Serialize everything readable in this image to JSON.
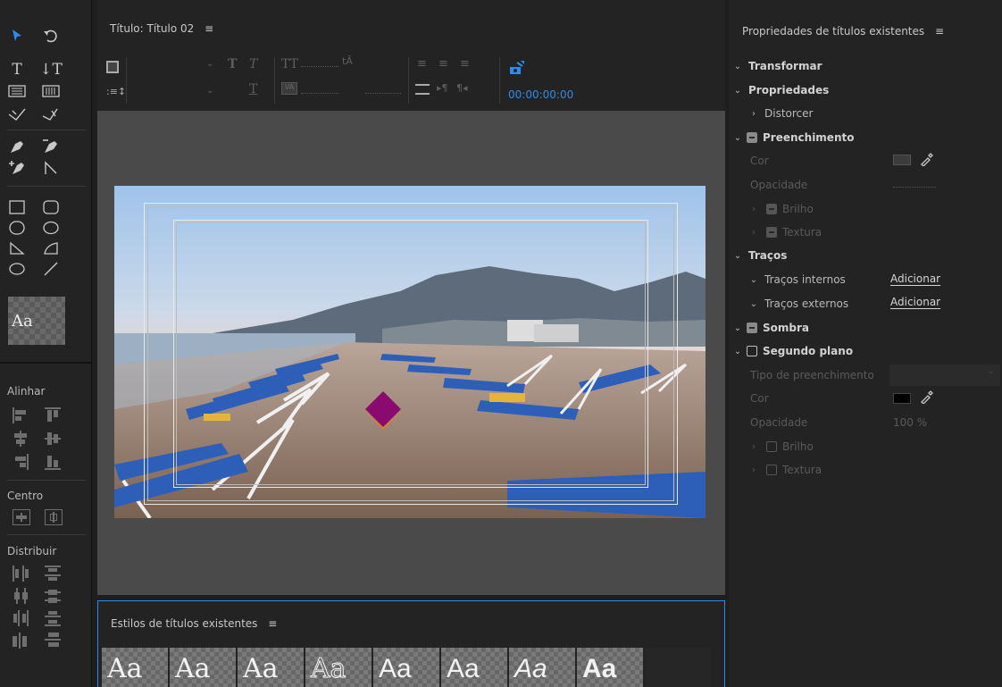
{
  "title_panel": {
    "heading": "Título: Título 02",
    "timecode": "00:00:00:00"
  },
  "tools_panel": {
    "align_label": "Alinhar",
    "center_label": "Centro",
    "distribute_label": "Distribuir",
    "style_swatch": "Aa"
  },
  "styles_panel": {
    "heading": "Estilos de títulos existentes",
    "tiles": [
      "Aa",
      "Aa",
      "Aa",
      "Aa",
      "Aa",
      "Aa",
      "Aa",
      "Aa"
    ]
  },
  "properties": {
    "heading": "Propriedades de títulos existentes",
    "transformar": "Transformar",
    "propriedades": "Propriedades",
    "distorcer": "Distorcer",
    "preenchimento": "Preenchimento",
    "cor": "Cor",
    "opacidade": "Opacidade",
    "brilho": "Brilho",
    "textura": "Textura",
    "tracos": "Traços",
    "tracos_internos": "Traços internos",
    "tracos_externos": "Traços externos",
    "adicionar": "Adicionar",
    "sombra": "Sombra",
    "segundo_plano": "Segundo plano",
    "tipo_preenchimento": "Tipo de preenchimento",
    "cor2": "Cor",
    "opacidade2": "Opacidade",
    "opacidade2_value": "100 %",
    "brilho2": "Brilho",
    "textura2": "Textura"
  },
  "colors": {
    "accent_blue": "#2d8ceb",
    "panel_bg": "#232323",
    "canvas_bg": "#4a4a4a",
    "logo_purple": "#8b0a6f",
    "logo_orange": "#f07d12"
  }
}
